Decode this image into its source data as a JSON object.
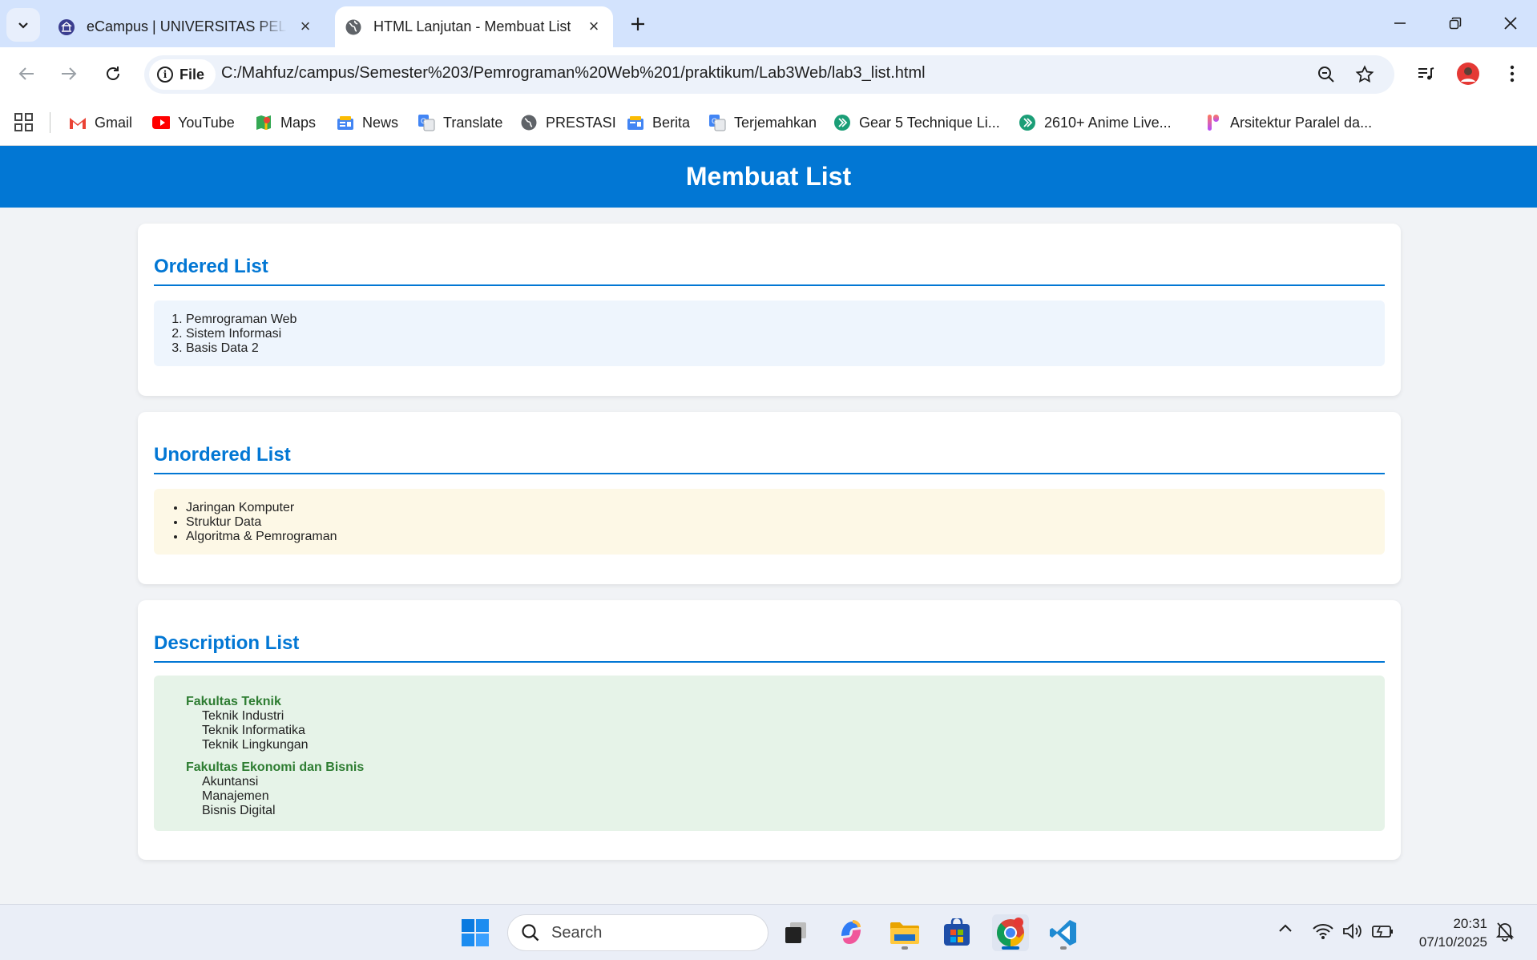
{
  "browser": {
    "tabs": [
      {
        "title": "eCampus | UNIVERSITAS PELITA",
        "active": false
      },
      {
        "title": "HTML Lanjutan - Membuat List",
        "active": true
      }
    ],
    "address": {
      "scheme_label": "File",
      "url": "C:/Mahfuz/campus/Semester%203/Pemrograman%20Web%201/praktikum/Lab3Web/lab3_list.html"
    },
    "bookmarks": [
      "Gmail",
      "YouTube",
      "Maps",
      "News",
      "Translate",
      "PRESTASI",
      "Berita",
      "Terjemahkan",
      "Gear 5 Technique Li...",
      "2610+ Anime Live...",
      "Arsitektur Paralel da..."
    ]
  },
  "page": {
    "title": "Membuat List",
    "ordered": {
      "heading": "Ordered List",
      "items": [
        "Pemrograman Web",
        "Sistem Informasi",
        "Basis Data 2"
      ]
    },
    "unordered": {
      "heading": "Unordered List",
      "items": [
        "Jaringan Komputer",
        "Struktur Data",
        "Algoritma & Pemrograman"
      ]
    },
    "description": {
      "heading": "Description List",
      "groups": [
        {
          "term": "Fakultas Teknik",
          "defs": [
            "Teknik Industri",
            "Teknik Informatika",
            "Teknik Lingkungan"
          ]
        },
        {
          "term": "Fakultas Ekonomi dan Bisnis",
          "defs": [
            "Akuntansi",
            "Manajemen",
            "Bisnis Digital"
          ]
        }
      ]
    }
  },
  "taskbar": {
    "search_placeholder": "Search",
    "time": "20:31",
    "date": "07/10/2025"
  },
  "colors": {
    "accent": "#0277d4",
    "term": "#2e7d32",
    "ordered_bg": "#eef5fd",
    "unordered_bg": "#fdf8e6",
    "description_bg": "#e6f3e8"
  }
}
